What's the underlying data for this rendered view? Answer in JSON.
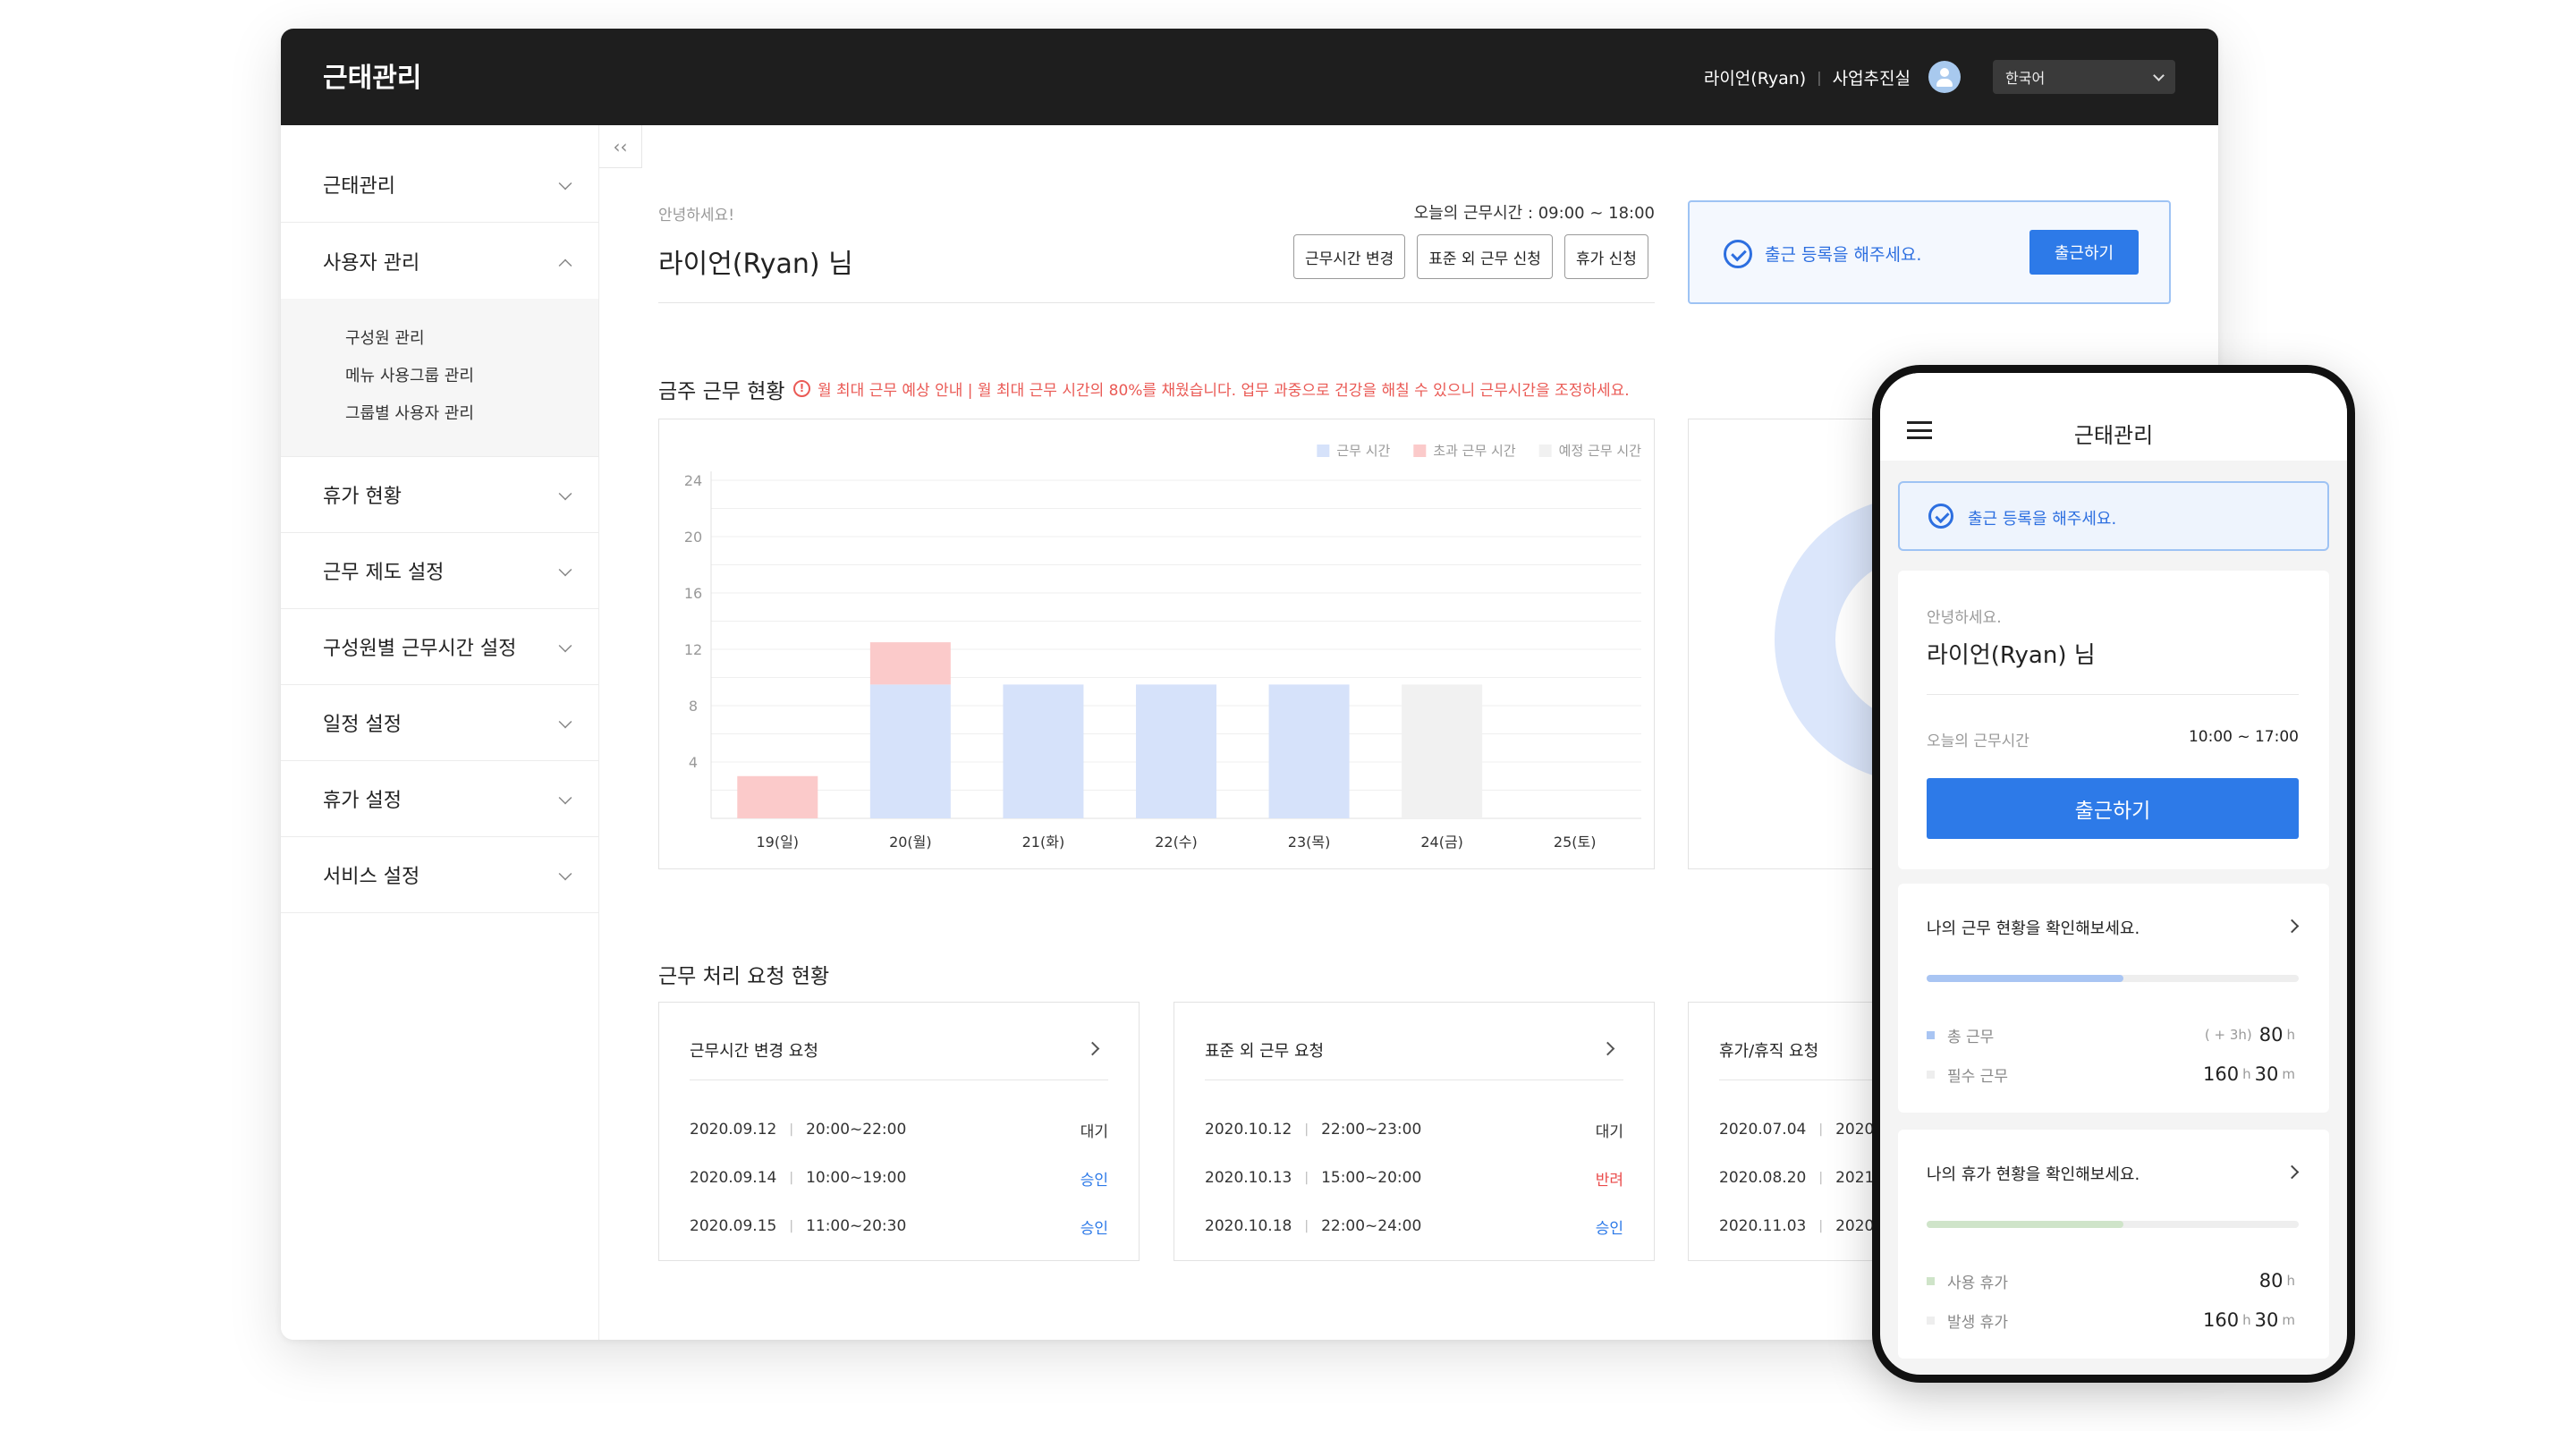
{
  "app": {
    "title": "근태관리",
    "user_name": "라이언(Ryan)",
    "department": "사업추진실",
    "language": "한국어"
  },
  "sidebar": {
    "items": [
      {
        "label": "근태관리"
      },
      {
        "label": "사용자 관리",
        "open": true
      },
      {
        "label": "휴가 현황"
      },
      {
        "label": "근무 제도 설정"
      },
      {
        "label": "구성원별 근무시간 설정"
      },
      {
        "label": "일정 설정"
      },
      {
        "label": "휴가 설정"
      },
      {
        "label": "서비스 설정"
      }
    ],
    "submenu": [
      "구성원 관리",
      "메뉴 사용그룹 관리",
      "그룹별 사용자 관리"
    ],
    "collapse_label": "‹‹"
  },
  "greeting": {
    "hello": "안녕하세요!",
    "name": "라이언(Ryan) 님",
    "work_time": "오늘의 근무시간 : 09:00 ~ 18:00"
  },
  "actions": {
    "change_hours": "근무시간 변경",
    "overtime_request": "표준 외 근무 신청",
    "leave_request": "휴가 신청"
  },
  "checkin": {
    "message": "출근 등록을 해주세요.",
    "button": "출근하기"
  },
  "weekly": {
    "title": "금주 근무 현황",
    "warning": "월 최대 근무 예상 안내 | 월 최대 근무 시간의 80%를 채웠습니다. 업무 과중으로 건강을 해칠 수 있으니 근무시간을 조정하세요."
  },
  "chart_data": {
    "type": "bar",
    "stacked": true,
    "categories": [
      "19(일)",
      "20(월)",
      "21(화)",
      "22(수)",
      "23(목)",
      "24(금)",
      "25(토)"
    ],
    "series": [
      {
        "name": "근무 시간",
        "color": "#d6e2fa",
        "values": [
          0,
          9.5,
          9.5,
          9.5,
          9.5,
          0,
          0
        ]
      },
      {
        "name": "초과 근무 시간",
        "color": "#fbcaca",
        "values": [
          3,
          3,
          0,
          0,
          0,
          0,
          0
        ]
      },
      {
        "name": "예정 근무 시간",
        "color": "#f1f1f1",
        "values": [
          0,
          0,
          0,
          0,
          0,
          9.5,
          0
        ]
      }
    ],
    "yticks": [
      4,
      8,
      12,
      16,
      20,
      24
    ],
    "ylim": [
      0,
      24
    ],
    "grid": true,
    "legend": "top-right"
  },
  "requests": {
    "title": "근무 처리 요청 현황",
    "cards": [
      {
        "title": "근무시간 변경 요청",
        "rows": [
          {
            "date": "2020.09.12",
            "range": "20:00~22:00",
            "status": "대기",
            "kind": "wait"
          },
          {
            "date": "2020.09.14",
            "range": "10:00~19:00",
            "status": "승인",
            "kind": "ok"
          },
          {
            "date": "2020.09.15",
            "range": "11:00~20:30",
            "status": "승인",
            "kind": "ok"
          }
        ]
      },
      {
        "title": "표준 외 근무 요청",
        "rows": [
          {
            "date": "2020.10.12",
            "range": "22:00~23:00",
            "status": "대기",
            "kind": "wait"
          },
          {
            "date": "2020.10.13",
            "range": "15:00~20:00",
            "status": "반려",
            "kind": "reject"
          },
          {
            "date": "2020.10.18",
            "range": "22:00~24:00",
            "status": "승인",
            "kind": "ok"
          }
        ]
      },
      {
        "title": "휴가/휴직 요청",
        "rows": [
          {
            "date": "2020.07.04",
            "range": "2020.1",
            "status": "",
            "kind": "wait"
          },
          {
            "date": "2020.08.20",
            "range": "2021.0",
            "status": "",
            "kind": "wait"
          },
          {
            "date": "2020.11.03",
            "range": "2020.1",
            "status": "",
            "kind": "wait"
          }
        ]
      }
    ]
  },
  "mobile": {
    "title": "근태관리",
    "checkin_message": "출근 등록을 해주세요.",
    "hello": "안녕하세요.",
    "name": "라이언(Ryan) 님",
    "work_time_label": "오늘의 근무시간",
    "work_time_value": "10:00 ~ 17:00",
    "checkin_button": "출근하기",
    "work_status": {
      "title": "나의 근무 현황을 확인해보세요.",
      "progress_fraction": 0.53,
      "progress_color": "#a9c5f3",
      "total_label": "총 근무",
      "total_extra": "( + 3h)",
      "total_value": "80",
      "total_unit": "h",
      "required_label": "필수 근무",
      "required_hours": "160",
      "required_minutes": "30",
      "unit_h": "h",
      "unit_m": "m"
    },
    "leave_status": {
      "title": "나의 휴가 현황을 확인해보세요.",
      "progress_fraction": 0.53,
      "progress_color": "#cfe4c9",
      "used_label": "사용 휴가",
      "used_value": "80",
      "used_unit": "h",
      "granted_label": "발생 휴가",
      "granted_hours": "160",
      "granted_minutes": "30",
      "unit_h": "h",
      "unit_m": "m"
    }
  }
}
